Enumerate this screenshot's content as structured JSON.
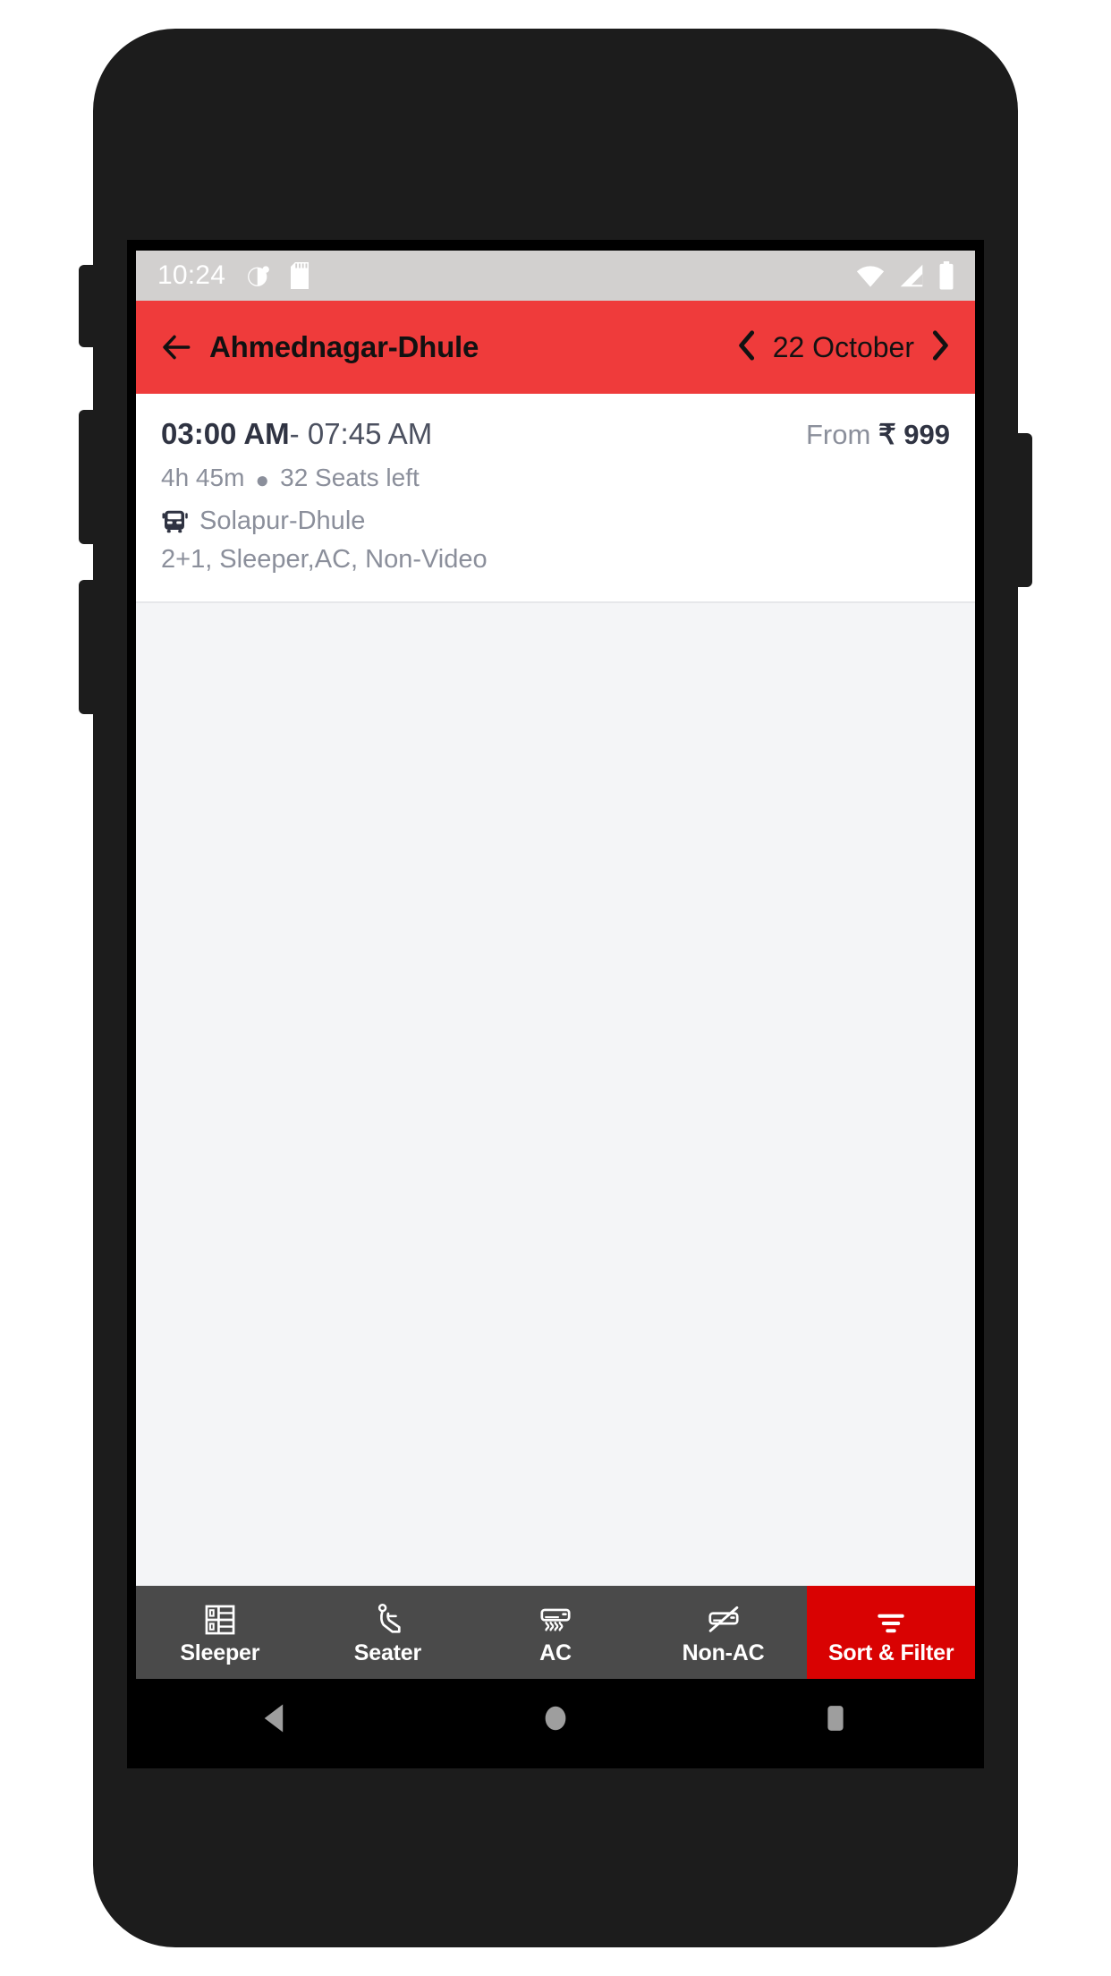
{
  "statusbar": {
    "time": "10:24",
    "left_icons": [
      "moon-icon",
      "sd-card-icon"
    ],
    "right_icons": [
      "wifi-icon",
      "cellular-signal-icon",
      "battery-icon"
    ],
    "bg_color": "#d2d0cf"
  },
  "appbar": {
    "back_icon": "back-arrow-icon",
    "title": "Ahmednagar-Dhule",
    "prev_icon": "chevron-left-icon",
    "date": "22 October",
    "next_icon": "chevron-right-icon",
    "bg_color": "#ef3b3b"
  },
  "results": {
    "buses": [
      {
        "departure_time": "03:00 AM",
        "separator": "-",
        "arrival_time": "07:45 AM",
        "price_prefix": "From",
        "price": "₹ 999",
        "duration": "4h 45m",
        "bullet": "●",
        "seats": "32 Seats left",
        "bus_icon": "bus-icon",
        "operator": "Solapur-Dhule",
        "bus_type": "2+1, Sleeper,AC, Non-Video"
      }
    ]
  },
  "filterbar": {
    "bg_color": "#4a4a4a",
    "accent_color": "#d90202",
    "items": [
      {
        "icon": "sleeper-berth-icon",
        "label": "Sleeper",
        "accent": false
      },
      {
        "icon": "seat-icon",
        "label": "Seater",
        "accent": false
      },
      {
        "icon": "air-conditioner-icon",
        "label": "AC",
        "accent": false
      },
      {
        "icon": "no-air-conditioner-icon",
        "label": "Non-AC",
        "accent": false
      },
      {
        "icon": "filter-funnel-icon",
        "label": "Sort & Filter",
        "accent": true
      }
    ]
  },
  "navbar": {
    "buttons": [
      "android-back-icon",
      "android-home-icon",
      "android-recents-icon"
    ],
    "bg_color": "#000000",
    "icon_color": "#9e9e9e"
  }
}
